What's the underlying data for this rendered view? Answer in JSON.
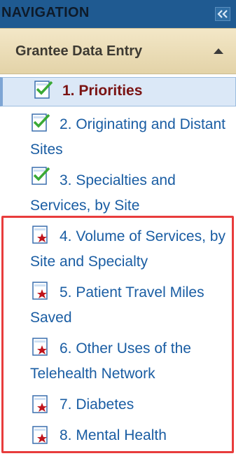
{
  "navigation": {
    "title": "NAVIGATION",
    "collapse_icon": "double-chevron-left-icon"
  },
  "section": {
    "title": "Grantee Data Entry",
    "toggle_icon": "triangle-up-icon"
  },
  "items": [
    {
      "label": "1. Priorities",
      "status": "complete",
      "icon": "checked-document-icon",
      "active": true
    },
    {
      "label": "2. Originating and Distant Sites",
      "status": "complete",
      "icon": "checked-document-icon"
    },
    {
      "label": "3. Specialties and Services, by Site",
      "status": "complete",
      "icon": "checked-document-icon"
    },
    {
      "label": "4. Volume of Services, by Site and Specialty",
      "status": "incomplete",
      "icon": "star-document-icon"
    },
    {
      "label": "5. Patient Travel Miles Saved",
      "status": "incomplete",
      "icon": "star-document-icon"
    },
    {
      "label": "6. Other Uses of the Telehealth Network",
      "status": "incomplete",
      "icon": "star-document-icon"
    },
    {
      "label": "7. Diabetes",
      "status": "incomplete",
      "icon": "star-document-icon"
    },
    {
      "label": "8. Mental Health",
      "status": "incomplete",
      "icon": "star-document-icon"
    }
  ],
  "colors": {
    "header_bg": "#1f5a91",
    "section_bg": "#e9dcb6",
    "link": "#1a5da3",
    "active_text": "#7a1313",
    "highlight": "#e83c3c"
  }
}
